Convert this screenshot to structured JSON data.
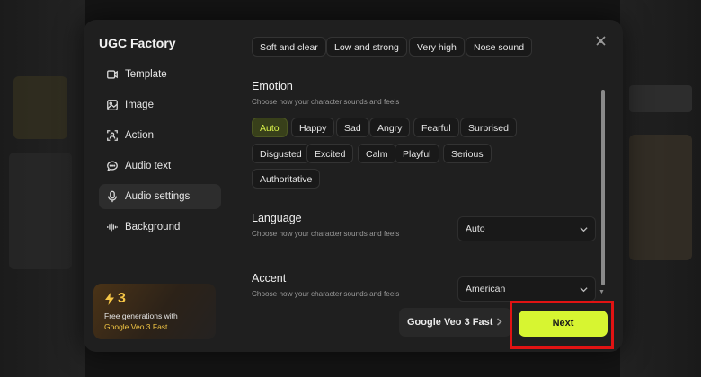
{
  "app": {
    "title": "UGC Factory"
  },
  "sidebar": {
    "items": [
      {
        "label": "Template",
        "icon": "template-icon"
      },
      {
        "label": "Image",
        "icon": "image-icon"
      },
      {
        "label": "Action",
        "icon": "action-icon"
      },
      {
        "label": "Audio text",
        "icon": "chat-bubble-icon"
      },
      {
        "label": "Audio settings",
        "icon": "microphone-icon",
        "active": true
      },
      {
        "label": "Background",
        "icon": "waveform-icon"
      }
    ]
  },
  "promo": {
    "count": "3",
    "line1": "Free generations with",
    "line2": "Google Veo 3 Fast",
    "accent": "#f2c544"
  },
  "voice_chips": [
    "Soft and clear",
    "Low and strong",
    "Very high",
    "Nose sound"
  ],
  "emotion": {
    "title": "Emotion",
    "subtitle": "Choose how your character sounds and feels",
    "chips": [
      "Auto",
      "Happy",
      "Sad",
      "Angry",
      "Fearful",
      "Surprised",
      "Disgusted",
      "Excited",
      "Calm",
      "Playful",
      "Serious",
      "Authoritative"
    ],
    "selected": "Auto"
  },
  "language": {
    "title": "Language",
    "subtitle": "Choose how your character sounds and feels",
    "value": "Auto"
  },
  "accent": {
    "title": "Accent",
    "subtitle": "Choose how your character sounds and feels",
    "value": "American"
  },
  "footer": {
    "model_label": "Google Veo 3 Fast",
    "next_label": "Next"
  },
  "colors": {
    "accent_lime": "#d7f531",
    "highlight_red": "#e11313"
  }
}
